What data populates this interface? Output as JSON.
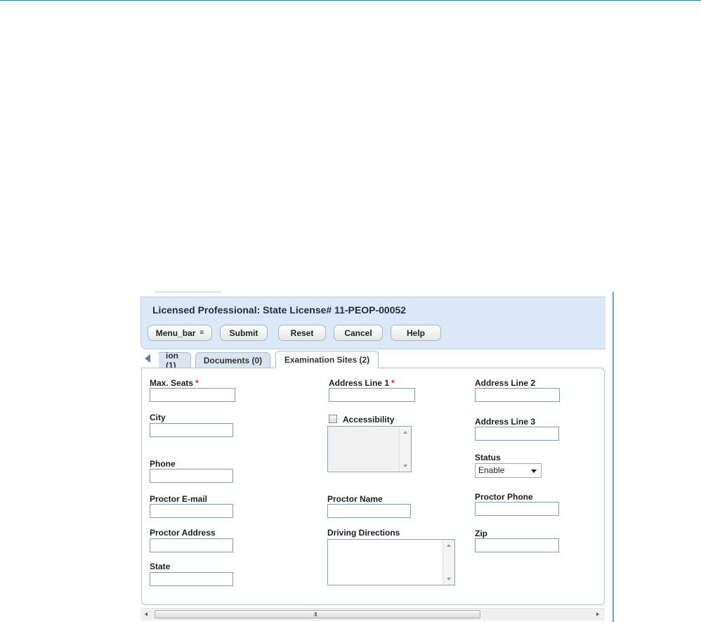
{
  "header": {
    "title": "Licensed Professional: State License# 11-PEOP-00052",
    "buttons": {
      "menu_bar": "Menu_bar",
      "submit": "Submit",
      "reset": "Reset",
      "cancel": "Cancel",
      "help": "Help"
    }
  },
  "tabs": [
    {
      "label": "ion (1)",
      "active": false
    },
    {
      "label": "Documents (0)",
      "active": false
    },
    {
      "label": "Examination Sites (2)",
      "active": true
    }
  ],
  "form": {
    "max_seats": {
      "label": "Max. Seats",
      "required": "*",
      "value": ""
    },
    "address_line_1": {
      "label": "Address Line 1",
      "required": "*",
      "value": ""
    },
    "address_line_2": {
      "label": "Address Line 2",
      "value": ""
    },
    "city": {
      "label": "City",
      "value": ""
    },
    "accessibility": {
      "label": "Accessibility",
      "checked": false,
      "value": ""
    },
    "address_line_3": {
      "label": "Address Line 3",
      "value": ""
    },
    "status": {
      "label": "Status",
      "value": "Enable"
    },
    "phone": {
      "label": "Phone",
      "value": ""
    },
    "proctor_email": {
      "label": "Proctor E-mail",
      "value": ""
    },
    "proctor_name": {
      "label": "Proctor Name",
      "value": ""
    },
    "proctor_phone": {
      "label": "Proctor Phone",
      "value": ""
    },
    "proctor_address": {
      "label": "Proctor Address",
      "value": ""
    },
    "driving_directions": {
      "label": "Driving Directions",
      "value": ""
    },
    "zip": {
      "label": "Zip",
      "value": ""
    },
    "state": {
      "label": "State",
      "value": ""
    }
  },
  "scrollbar": {
    "grip": "III"
  },
  "colors": {
    "header_bg": "#dce8f5",
    "top_rule": "#2e87a8",
    "required": "#e02020",
    "input_border": "#7f9db9"
  }
}
